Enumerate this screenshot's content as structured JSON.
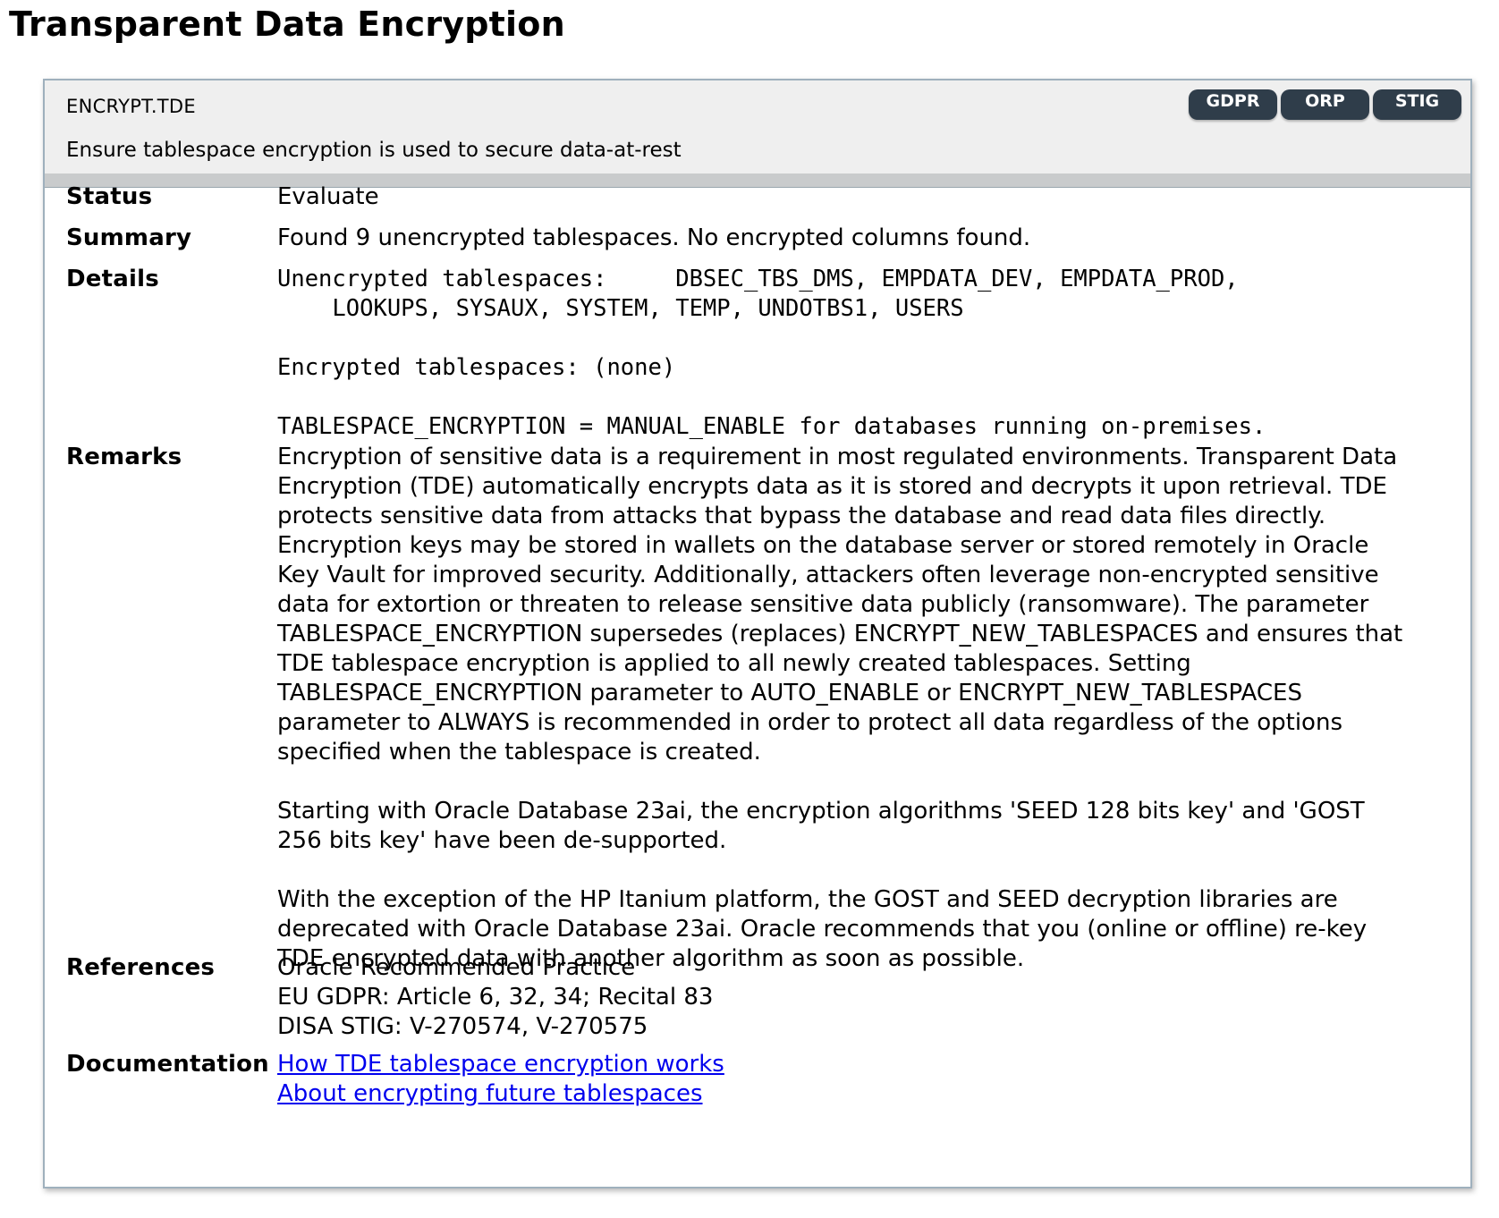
{
  "page": {
    "title": "Transparent Data Encryption"
  },
  "rule": {
    "id": "ENCRYPT.TDE",
    "description": "Ensure tablespace encryption is used to secure data-at-rest",
    "badges": [
      "GDPR",
      "ORP",
      "STIG"
    ]
  },
  "labels": {
    "status": "Status",
    "summary": "Summary",
    "details": "Details",
    "remarks": "Remarks",
    "references": "References",
    "documentation": "Documentation"
  },
  "status": "Evaluate",
  "summary": "Found 9 unencrypted tablespaces. No encrypted columns found.",
  "details": {
    "line1": "Unencrypted tablespaces:     DBSEC_TBS_DMS, EMPDATA_DEV, EMPDATA_PROD,",
    "line2": "    LOOKUPS, SYSAUX, SYSTEM, TEMP, UNDOTBS1, USERS",
    "line3": "Encrypted tablespaces: (none)",
    "line4": "TABLESPACE_ENCRYPTION = MANUAL_ENABLE for databases running on-premises."
  },
  "remarks": {
    "p1": [
      "Encryption of sensitive data is a requirement in most regulated environments. Transparent Data",
      "Encryption (TDE) automatically encrypts data as it is stored and decrypts it upon retrieval. TDE",
      "protects sensitive data from attacks that bypass the database and read data files directly.",
      "Encryption keys may be stored in wallets on the database server or stored remotely in Oracle",
      "Key Vault for improved security. Additionally, attackers often leverage non-encrypted sensitive",
      "data for extortion or threaten to release sensitive data publicly (ransomware). The parameter",
      "TABLESPACE_ENCRYPTION supersedes (replaces) ENCRYPT_NEW_TABLESPACES and ensures that",
      "TDE tablespace encryption is applied to all newly created tablespaces. Setting",
      "TABLESPACE_ENCRYPTION parameter to AUTO_ENABLE or ENCRYPT_NEW_TABLESPACES",
      "parameter to ALWAYS is recommended in order to protect all data regardless of the options",
      "specified when the tablespace is created."
    ],
    "p2": [
      "Starting with Oracle Database 23ai, the encryption algorithms 'SEED 128 bits key' and 'GOST",
      "256 bits key' have been de-supported."
    ],
    "p3": [
      "With the exception of the HP Itanium platform, the GOST and SEED decryption libraries are",
      "deprecated with Oracle Database 23ai. Oracle recommends that you (online or offline) re-key",
      "TDE encrypted data with another algorithm as soon as possible."
    ]
  },
  "references": [
    "Oracle Recommended Practice",
    "EU GDPR: Article 6, 32, 34; Recital 83",
    "DISA STIG: V-270574, V-270575"
  ],
  "documentation": [
    "How TDE tablespace encryption works",
    "About encrypting future tablespaces"
  ]
}
